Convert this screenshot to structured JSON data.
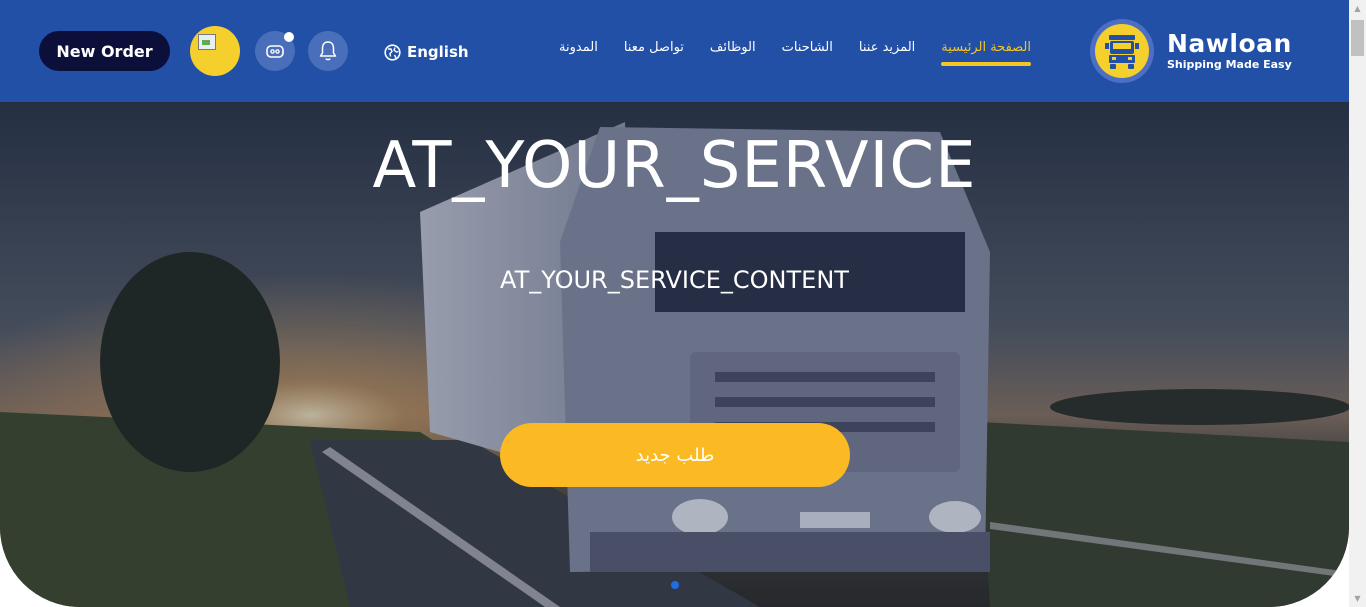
{
  "header": {
    "new_order_label": "New Order",
    "language_label": "English",
    "nav": [
      {
        "label": "الصفحة الرئيسية",
        "active": true
      },
      {
        "label": "المزيد عننا",
        "active": false
      },
      {
        "label": "الشاحنات",
        "active": false
      },
      {
        "label": "الوظائف",
        "active": false
      },
      {
        "label": "تواصل معنا",
        "active": false
      },
      {
        "label": "المدونة",
        "active": false
      }
    ],
    "logo": {
      "name": "Nawloan",
      "tagline": "Shipping Made Easy"
    },
    "icons": {
      "language": "globe-icon",
      "chat": "chat-bot-icon",
      "notifications": "bell-icon",
      "logo": "truck-icon",
      "avatar": "broken-image-icon"
    }
  },
  "hero": {
    "title": "AT_YOUR_SERVICE",
    "content": "AT_YOUR_SERVICE_CONTENT",
    "cta_label": "طلب جديد",
    "slides": {
      "current": 1
    }
  },
  "colors": {
    "navbar": "#2150a6",
    "accent": "#f5c523",
    "cta": "#fbba23",
    "new_order": "#0b0f3a",
    "slider_dot": "#1f6ee8"
  }
}
